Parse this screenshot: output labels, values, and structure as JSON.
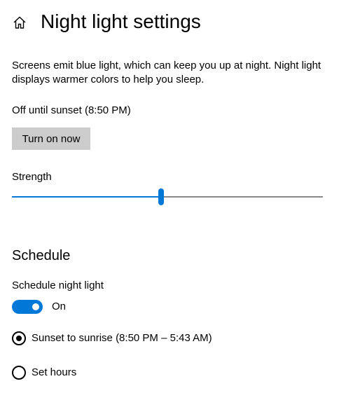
{
  "header": {
    "icon": "home-icon",
    "title": "Night light settings"
  },
  "description": "Screens emit blue light, which can keep you up at night. Night light displays warmer colors to help you sleep.",
  "status_text": "Off until sunset (8:50 PM)",
  "turn_on_button_label": "Turn on now",
  "strength": {
    "label": "Strength",
    "value_percent": 48
  },
  "schedule": {
    "section_title": "Schedule",
    "toggle_label": "Schedule night light",
    "toggle_state_text": "On",
    "toggle_on": true,
    "options": [
      {
        "label": "Sunset to sunrise (8:50 PM – 5:43 AM)",
        "selected": true
      },
      {
        "label": "Set hours",
        "selected": false
      }
    ]
  },
  "colors": {
    "accent": "#0078d7",
    "button_bg": "#cccccc",
    "track": "#8a8a8a"
  }
}
